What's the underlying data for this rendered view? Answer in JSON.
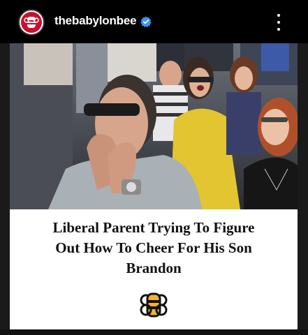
{
  "header": {
    "username": "thebabylonbee",
    "avatar_icon": "babylon-bee-logo-icon",
    "verified_icon": "verified-badge-icon",
    "verified_color": "#3897f0",
    "more_icon": "more-options-icon"
  },
  "post": {
    "image_icon": "crowd-photo",
    "caption_lines": [
      "Liberal Parent Trying To Figure",
      "Out How To Cheer For His Son",
      "Brandon"
    ],
    "logo_icon": "babylon-bee-logo-icon",
    "logo_color": "#f2b134"
  }
}
